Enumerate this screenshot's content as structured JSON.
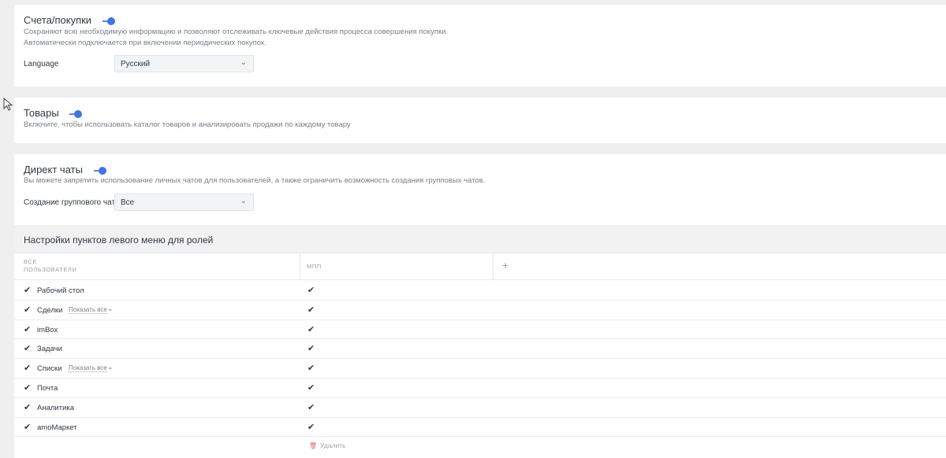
{
  "invoices": {
    "title": "Счета/покупки",
    "desc1": "Сохраняют всю необходимую информацию и позволяют отслеживать ключевые действия процесса совершения покупки.",
    "desc2": "Автоматически подключается при включении периодических покупок.",
    "language_label": "Language",
    "language_value": "Русский"
  },
  "products": {
    "title": "Товары",
    "desc": "Включите, чтобы использовать каталог товаров и анализировать продажи по каждому товару"
  },
  "direct_chats": {
    "title": "Директ чаты",
    "desc": "Вы можете запретить использование личных чатов для пользователей, а также ограничить возможность создания групповых чатов.",
    "group_label": "Создание группового чата",
    "group_value": "Все"
  },
  "menu_settings": {
    "title": "Настройки пунктов левого меню для ролей",
    "col1_line1": "ВСЕ",
    "col1_line2": "ПОЛЬЗОВАТЕЛИ",
    "col2": "МПП",
    "add": "+",
    "show_all": "Показать все",
    "rows": [
      {
        "label": "Рабочий стол"
      },
      {
        "label": "Сделки"
      },
      {
        "label": "imBox"
      },
      {
        "label": "Задачи"
      },
      {
        "label": "Списки"
      },
      {
        "label": "Почта"
      },
      {
        "label": "Аналитика"
      },
      {
        "label": "amoМаркет"
      }
    ],
    "delete": "Удалить"
  },
  "icons": {
    "check": "✔",
    "chevron": "⌄",
    "trash": "🗑"
  },
  "colors": {
    "toggle": "#3f73e8",
    "background": "#efefef"
  }
}
